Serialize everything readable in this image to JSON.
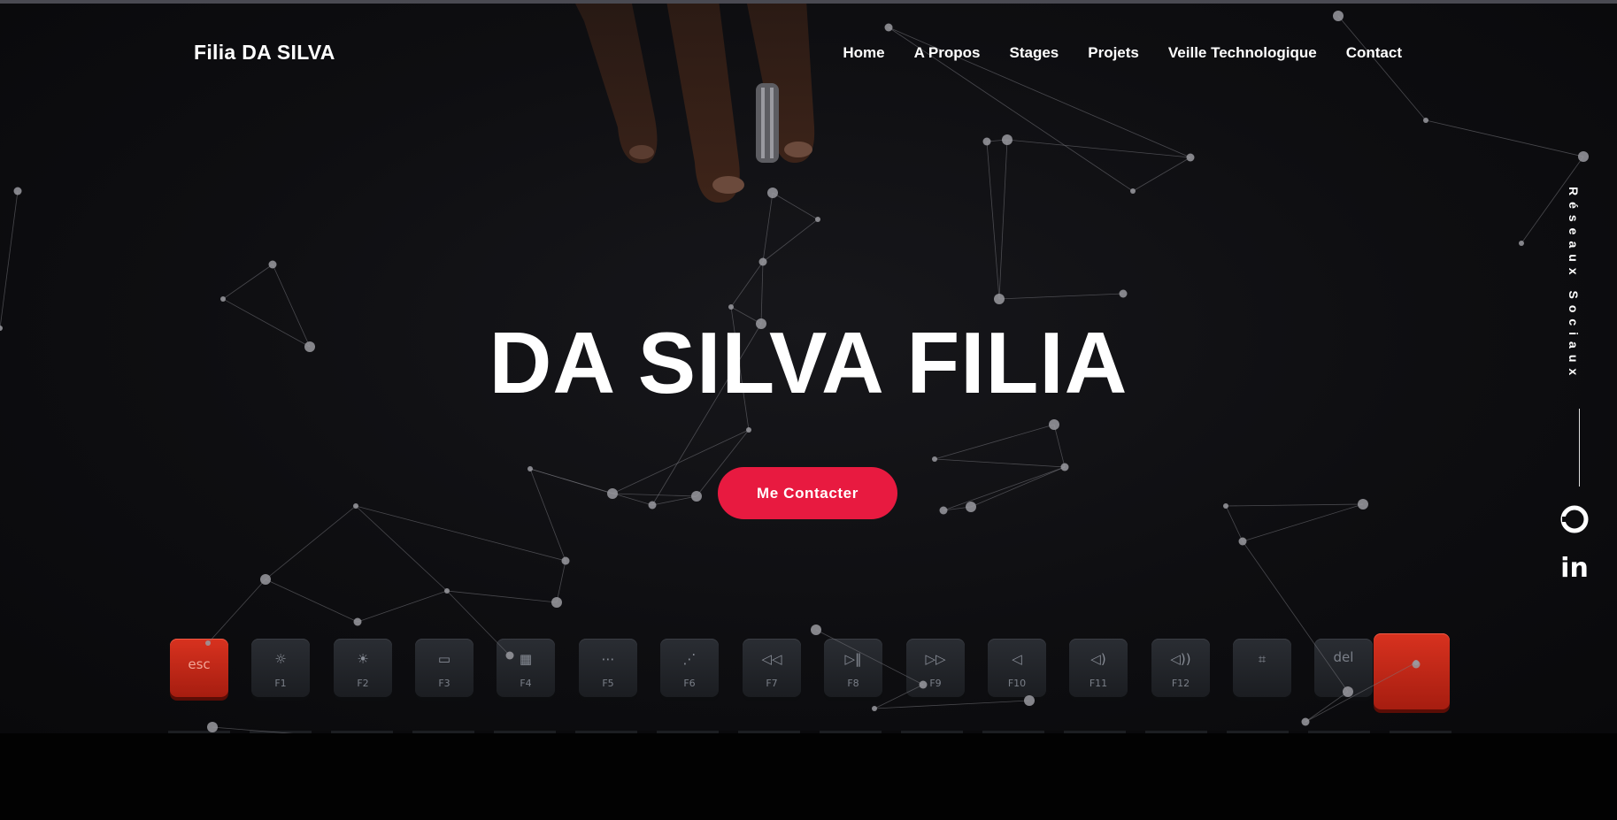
{
  "brand": "Filia DA SILVA",
  "nav": {
    "items": [
      "Home",
      "A Propos",
      "Stages",
      "Projets",
      "Veille Technologique",
      "Contact"
    ]
  },
  "hero": {
    "title": "DA SILVA FILIA",
    "cta_label": "Me Contacter"
  },
  "social": {
    "label": "Réseaux Sociaux",
    "icons": [
      "github-icon",
      "linkedin-icon"
    ],
    "linkedin_glyph": "in"
  },
  "keyboard": {
    "keys": [
      "esc",
      "F1",
      "F2",
      "F3",
      "F4",
      "F5",
      "F6",
      "F7",
      "F8",
      "F9",
      "F10",
      "F11",
      "F12",
      "",
      "del",
      ""
    ]
  },
  "colors": {
    "accent": "#e81a40",
    "background": "#0e0e11",
    "text": "#ffffff"
  }
}
